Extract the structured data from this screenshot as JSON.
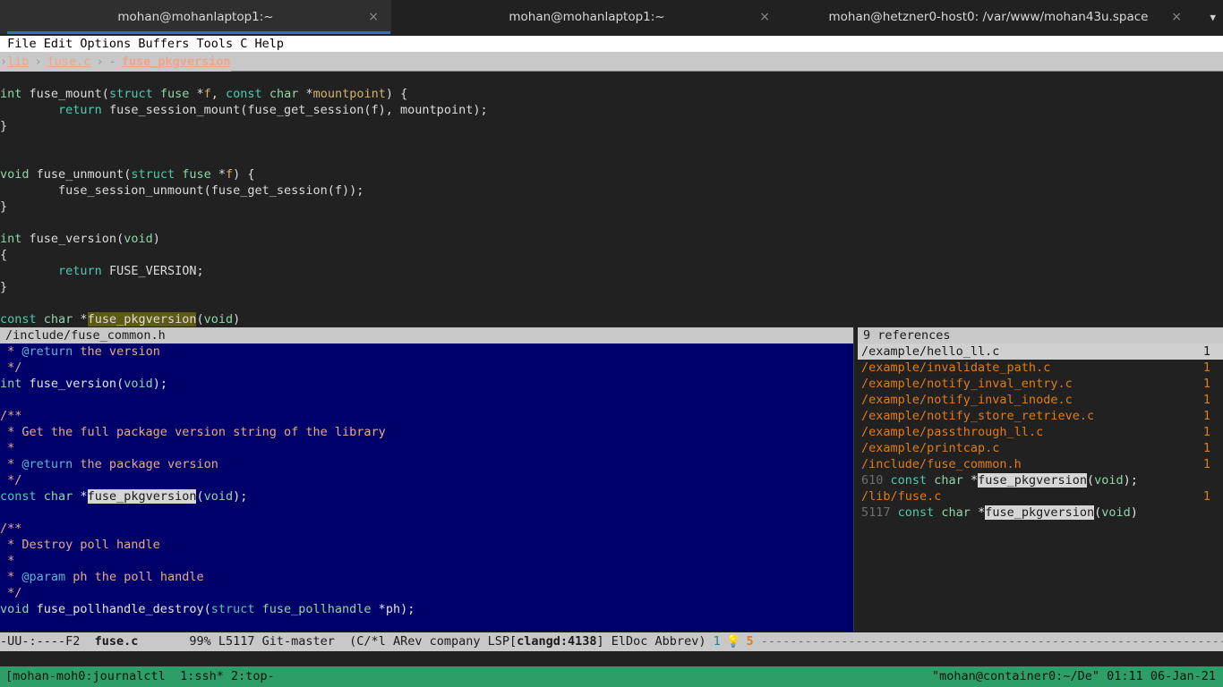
{
  "window": {
    "tabs": [
      {
        "title": "mohan@mohanlaptop1:~",
        "close_label": "×",
        "active": true
      },
      {
        "title": "mohan@mohanlaptop1:~",
        "close_label": "×",
        "active": false
      },
      {
        "title": "mohan@hetzner0-host0: /var/www/mohan43u.space",
        "close_label": "×",
        "active": false
      }
    ],
    "tab_menu_icon": "▼",
    "accent_color": "#2f73c8"
  },
  "menubar": {
    "text": " File Edit Options Buffers Tools C Help"
  },
  "breadcrumb": {
    "chevron": "›",
    "seg1": "lib",
    "seg2": "fuse.c",
    "dash": "-",
    "symbol": "fuse_pkgversion"
  },
  "buffer": {
    "lines": [
      [
        {
          "t": "int ",
          "c": "k-type"
        },
        {
          "t": "fuse_mount",
          "c": "k-plain"
        },
        {
          "t": "(",
          "c": "k-punct"
        },
        {
          "t": "struct ",
          "c": "k-kw"
        },
        {
          "t": "fuse ",
          "c": "k-type"
        },
        {
          "t": "*",
          "c": "k-punct"
        },
        {
          "t": "f",
          "c": "k-var"
        },
        {
          "t": ", ",
          "c": "k-punct"
        },
        {
          "t": "const ",
          "c": "k-kw"
        },
        {
          "t": "char ",
          "c": "k-type"
        },
        {
          "t": "*",
          "c": "k-punct"
        },
        {
          "t": "mountpoint",
          "c": "k-var"
        },
        {
          "t": ") {",
          "c": "k-punct"
        }
      ],
      [
        {
          "t": "        ",
          "c": "k-plain"
        },
        {
          "t": "return",
          "c": "k-kw"
        },
        {
          "t": " fuse_session_mount(fuse_get_session(f), mountpoint);",
          "c": "k-plain"
        }
      ],
      [
        {
          "t": "}",
          "c": "k-punct"
        }
      ],
      [
        {
          "t": "",
          "c": "k-plain"
        }
      ],
      [
        {
          "t": "",
          "c": "k-plain"
        }
      ],
      [
        {
          "t": "void ",
          "c": "k-type"
        },
        {
          "t": "fuse_unmount",
          "c": "k-plain"
        },
        {
          "t": "(",
          "c": "k-punct"
        },
        {
          "t": "struct ",
          "c": "k-kw"
        },
        {
          "t": "fuse ",
          "c": "k-type"
        },
        {
          "t": "*",
          "c": "k-punct"
        },
        {
          "t": "f",
          "c": "k-var"
        },
        {
          "t": ") {",
          "c": "k-punct"
        }
      ],
      [
        {
          "t": "        fuse_session_unmount(fuse_get_session(f));",
          "c": "k-plain"
        }
      ],
      [
        {
          "t": "}",
          "c": "k-punct"
        }
      ],
      [
        {
          "t": "",
          "c": "k-plain"
        }
      ],
      [
        {
          "t": "int ",
          "c": "k-type"
        },
        {
          "t": "fuse_version",
          "c": "k-plain"
        },
        {
          "t": "(",
          "c": "k-punct"
        },
        {
          "t": "void",
          "c": "k-type"
        },
        {
          "t": ")",
          "c": "k-punct"
        }
      ],
      [
        {
          "t": "{",
          "c": "k-punct"
        }
      ],
      [
        {
          "t": "        ",
          "c": "k-plain"
        },
        {
          "t": "return",
          "c": "k-kw"
        },
        {
          "t": " FUSE_VERSION;",
          "c": "k-plain"
        }
      ],
      [
        {
          "t": "}",
          "c": "k-punct"
        }
      ],
      [
        {
          "t": "",
          "c": "k-plain"
        }
      ],
      [
        {
          "t": "const ",
          "c": "k-kw"
        },
        {
          "t": "char ",
          "c": "k-type"
        },
        {
          "t": "*",
          "c": "k-punct"
        },
        {
          "t": "fuse_pkgversion",
          "c": "hl-sym"
        },
        {
          "t": "(",
          "c": "k-punct"
        },
        {
          "t": "void",
          "c": "k-type"
        },
        {
          "t": ")",
          "c": "k-punct"
        }
      ]
    ]
  },
  "doc_popup": {
    "header": "/include/fuse_common.h",
    "lines": [
      [
        {
          "t": " * ",
          "c": "d-comment"
        },
        {
          "t": "@return",
          "c": "d-tag"
        },
        {
          "t": " the version",
          "c": "d-comment"
        }
      ],
      [
        {
          "t": " */",
          "c": "d-comment"
        }
      ],
      [
        {
          "t": "int ",
          "c": "d-type"
        },
        {
          "t": "fuse_version",
          "c": "d-plain"
        },
        {
          "t": "(",
          "c": "d-plain"
        },
        {
          "t": "void",
          "c": "d-type"
        },
        {
          "t": ");",
          "c": "d-plain"
        }
      ],
      [
        {
          "t": "",
          "c": "d-plain"
        }
      ],
      [
        {
          "t": "/**",
          "c": "d-comment"
        }
      ],
      [
        {
          "t": " * Get the full package version string of the library",
          "c": "d-comment"
        }
      ],
      [
        {
          "t": " *",
          "c": "d-comment"
        }
      ],
      [
        {
          "t": " * ",
          "c": "d-comment"
        },
        {
          "t": "@return",
          "c": "d-tag"
        },
        {
          "t": " the package version",
          "c": "d-comment"
        }
      ],
      [
        {
          "t": " */",
          "c": "d-comment"
        }
      ],
      [
        {
          "t": "const ",
          "c": "d-kw"
        },
        {
          "t": "char ",
          "c": "d-type"
        },
        {
          "t": "*",
          "c": "d-plain"
        },
        {
          "t": "fuse_pkgversion",
          "c": "d-hl"
        },
        {
          "t": "(",
          "c": "d-plain"
        },
        {
          "t": "void",
          "c": "d-type"
        },
        {
          "t": ");",
          "c": "d-plain"
        }
      ],
      [
        {
          "t": "",
          "c": "d-plain"
        }
      ],
      [
        {
          "t": "/**",
          "c": "d-comment"
        }
      ],
      [
        {
          "t": " * Destroy poll handle",
          "c": "d-comment"
        }
      ],
      [
        {
          "t": " *",
          "c": "d-comment"
        }
      ],
      [
        {
          "t": " * ",
          "c": "d-comment"
        },
        {
          "t": "@param",
          "c": "d-tag"
        },
        {
          "t": " ph the poll handle",
          "c": "d-comment"
        }
      ],
      [
        {
          "t": " */",
          "c": "d-comment"
        }
      ],
      [
        {
          "t": "void ",
          "c": "d-type"
        },
        {
          "t": "fuse_pollhandle_destroy",
          "c": "d-plain"
        },
        {
          "t": "(",
          "c": "d-plain"
        },
        {
          "t": "struct ",
          "c": "d-kw"
        },
        {
          "t": "fuse_pollhandle ",
          "c": "d-type"
        },
        {
          "t": "*",
          "c": "d-plain"
        },
        {
          "t": "ph",
          "c": "d-plain"
        },
        {
          "t": ");",
          "c": "d-plain"
        }
      ]
    ]
  },
  "references": {
    "header": "9 references",
    "rows": [
      {
        "kind": "file",
        "path": "/example/hello_ll.c",
        "count": "1",
        "selected": true
      },
      {
        "kind": "file",
        "path": "/example/invalidate_path.c",
        "count": "1",
        "selected": false
      },
      {
        "kind": "file",
        "path": "/example/notify_inval_entry.c",
        "count": "1",
        "selected": false
      },
      {
        "kind": "file",
        "path": "/example/notify_inval_inode.c",
        "count": "1",
        "selected": false
      },
      {
        "kind": "file",
        "path": "/example/notify_store_retrieve.c",
        "count": "1",
        "selected": false
      },
      {
        "kind": "file",
        "path": "/example/passthrough_ll.c",
        "count": "1",
        "selected": false
      },
      {
        "kind": "file",
        "path": "/example/printcap.c",
        "count": "1",
        "selected": false
      },
      {
        "kind": "file",
        "path": "/include/fuse_common.h",
        "count": "1",
        "selected": false
      },
      {
        "kind": "code",
        "lineno": "610",
        "segments": [
          {
            "t": "const ",
            "c": "d-kw"
          },
          {
            "t": "char ",
            "c": "d-type"
          },
          {
            "t": "*",
            "c": "d-plain"
          },
          {
            "t": "fuse_pkgversion",
            "c": "d-hl"
          },
          {
            "t": "(",
            "c": "d-plain"
          },
          {
            "t": "void",
            "c": "d-type"
          },
          {
            "t": ");",
            "c": "d-plain"
          }
        ]
      },
      {
        "kind": "file",
        "path": "/lib/fuse.c",
        "count": "1",
        "selected": false
      },
      {
        "kind": "code",
        "lineno": "5117",
        "segments": [
          {
            "t": "const ",
            "c": "d-kw"
          },
          {
            "t": "char ",
            "c": "d-type"
          },
          {
            "t": "*",
            "c": "d-plain"
          },
          {
            "t": "fuse_pkgversion",
            "c": "d-hl"
          },
          {
            "t": "(",
            "c": "d-plain"
          },
          {
            "t": "void",
            "c": "d-type"
          },
          {
            "t": ")",
            "c": "d-plain"
          }
        ]
      }
    ]
  },
  "modeline": {
    "prefix": "-UU-:----F2  ",
    "buffer_name": "fuse.c",
    "gap": "       ",
    "position": "99% L5117 Git-master",
    "modes": "  (C/*l ARev company LSP[",
    "lsp_server": "clangd:4138",
    "modes_tail": "] ElDoc Abbrev) ",
    "error_count": "1",
    "bulb_icon": "💡",
    "warn_count": "5",
    "filler": " ----------------------------------------------------------------"
  },
  "tmux": {
    "left": "[mohan-moh0:journalctl  1:ssh* 2:top-",
    "right": "\"mohan@container0:~/De\" 01:11 06-Jan-21"
  }
}
